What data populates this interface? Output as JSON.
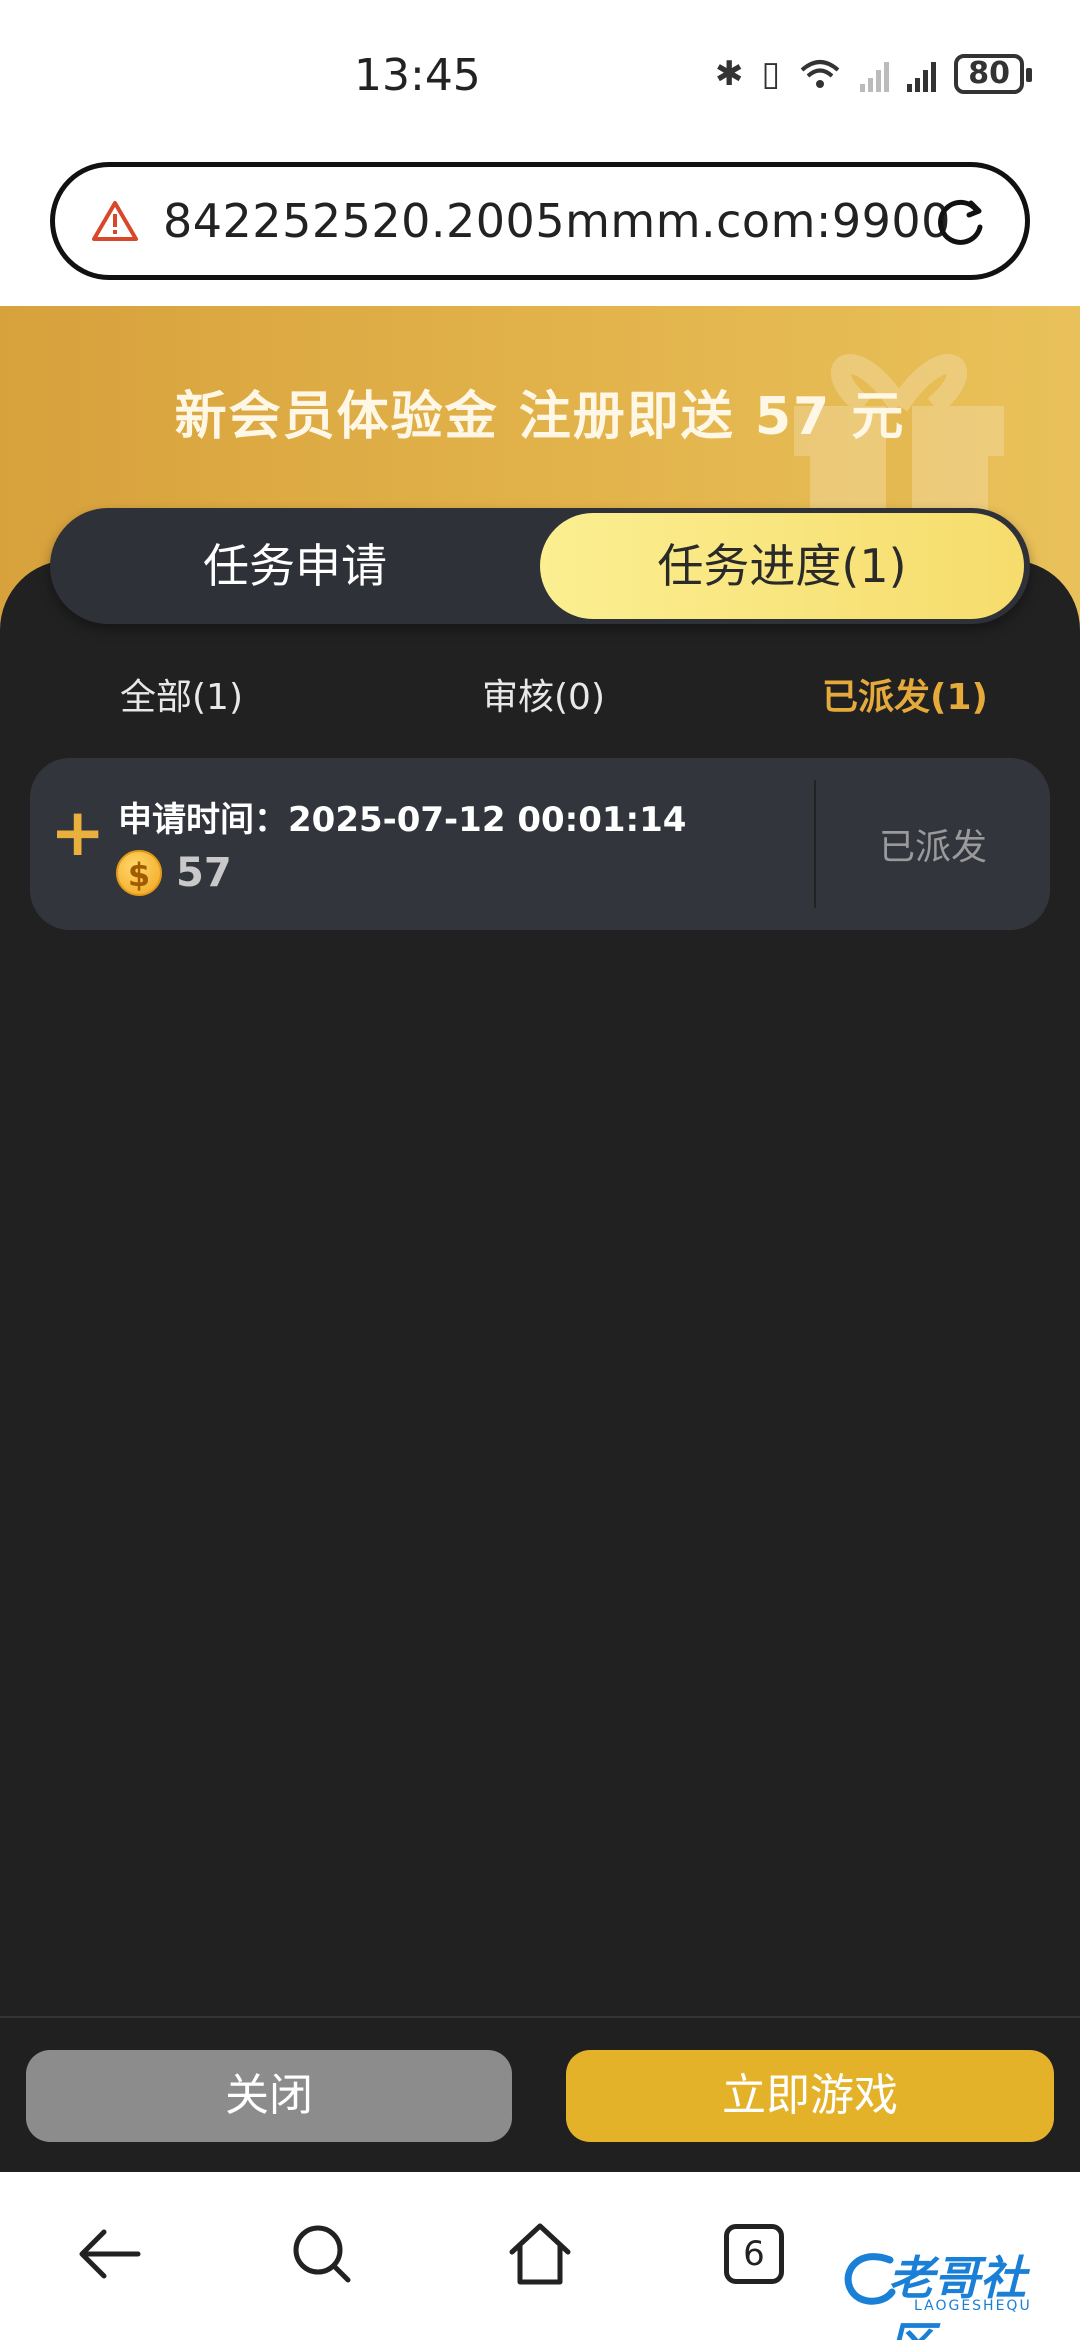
{
  "status_bar": {
    "time": "13:45",
    "battery": "80"
  },
  "url_bar": {
    "url": "842252520.2005mmm.com:9900"
  },
  "banner": {
    "title": "新会员体验金 注册即送 57 元"
  },
  "segment_tabs": [
    {
      "label": "任务申请",
      "active": false
    },
    {
      "label": "任务进度(1)",
      "active": true
    }
  ],
  "sub_tabs": [
    {
      "label": "全部(1)",
      "active": false
    },
    {
      "label": "审核(0)",
      "active": false
    },
    {
      "label": "已派发(1)",
      "active": true
    }
  ],
  "records": [
    {
      "time_label": "申请时间：2025-07-12 00:01:14",
      "coin_symbol": "$",
      "amount": "57",
      "status": "已派发"
    }
  ],
  "footer": {
    "close_label": "关闭",
    "play_label": "立即游戏"
  },
  "browser_nav": {
    "tab_count": "6"
  },
  "watermark": {
    "text": "老哥社区",
    "sub": "LAOGESHEQU"
  },
  "colors": {
    "accent_gold": "#e6aa3b",
    "panel_bg": "#212121",
    "card_bg": "#33353d"
  }
}
